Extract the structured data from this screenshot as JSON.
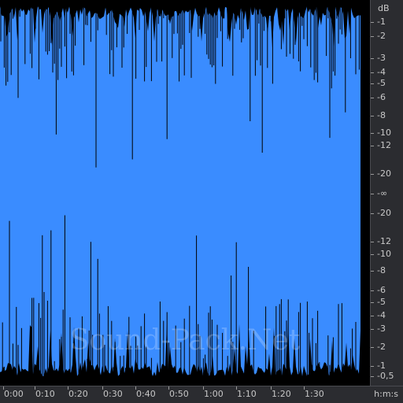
{
  "app": {
    "watermark": "Sound-Pack.Net"
  },
  "colors": {
    "waveform": "#3a8cff",
    "background": "#000000",
    "ruler": "#2b2c30",
    "ruler_text": "#c8c8c8"
  },
  "db_ruler": {
    "unit": "dB",
    "labels": [
      "-1",
      "-2",
      "-3",
      "-4",
      "-5",
      "-6",
      "-8",
      "-10",
      "-12",
      "-20",
      "-∞",
      "-20",
      "-12",
      "-10",
      "-8",
      "-6",
      "-5",
      "-4",
      "-3",
      "-2",
      "-1",
      "-0,5"
    ]
  },
  "time_ruler": {
    "labels": [
      "0:00",
      "0:10",
      "0:20",
      "0:30",
      "0:40",
      "0:50",
      "1:00",
      "1:10",
      "1:20",
      "1:30"
    ],
    "unit": "h:m:s"
  }
}
